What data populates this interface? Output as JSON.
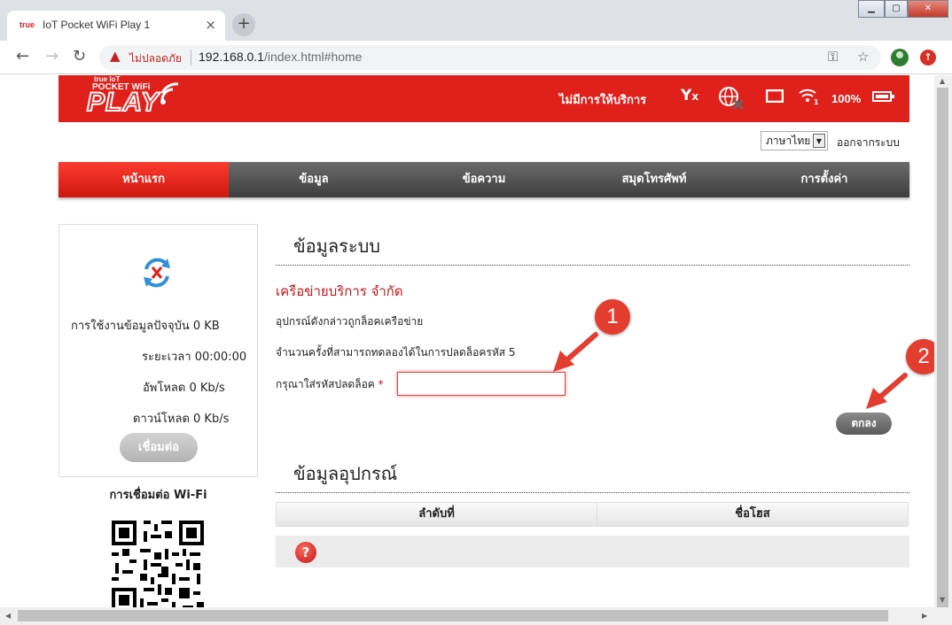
{
  "browser": {
    "tab_title": "IoT Pocket WiFi Play 1",
    "tab_favicon": "true",
    "url_security_label": "ไม่ปลอดภัย",
    "url_host": "192.168.0.1",
    "url_path": "/index.html#home",
    "window_controls": [
      "minimize",
      "maximize",
      "close"
    ]
  },
  "header": {
    "logo_small": "true IoT",
    "logo_pocket_wifi": "POCKET WiFi",
    "logo_play": "PLAY",
    "status_text": "ไม่มีการให้บริการ",
    "signal_icon_label": "Tx",
    "battery_percent": "100%",
    "accent_color": "#e0201b"
  },
  "top_links": {
    "language": "ภาษาไทย",
    "logout": "ออกจากระบบ"
  },
  "nav": {
    "items": [
      {
        "label": "หน้าแรก",
        "active": true
      },
      {
        "label": "ข้อมูล"
      },
      {
        "label": "ข้อความ"
      },
      {
        "label": "สมุดโทรศัพท์"
      },
      {
        "label": "การตั้งค่า"
      }
    ]
  },
  "left_panel": {
    "current_usage_label": "การใช้งานข้อมูลปัจจุบัน",
    "current_usage_value": "0 KB",
    "duration_label": "ระยะเวลา",
    "duration_value": "00:00:00",
    "upload_label": "อัพโหลด",
    "upload_value": "0 Kb/s",
    "download_label": "ดาวน์โหลด",
    "download_value": "0 Kb/s",
    "connect_button": "เชื่อมต่อ",
    "wifi_title": "การเชื่อมต่อ Wi-Fi"
  },
  "system_info": {
    "title": "ข้อมูลระบบ",
    "carrier": "เครือข่ายบริการ จำกัด",
    "locked_msg": "อุปกรณ์ดังกล่าวถูกล็อคเครือข่าย",
    "attempts_msg": "จำนวนครั้งที่สามารถทดลองได้ในการปลดล็อครหัส 5",
    "pin_label": "กรุณาใส่รหัสปลดล็อค",
    "pin_required": "*",
    "pin_value": "",
    "ok_button": "ตกลง"
  },
  "device_info": {
    "title": "ข้อมูลอุปกรณ์",
    "columns": [
      "ลำดับที่",
      "ชื่อโฮส"
    ]
  },
  "annotations": {
    "badge_1": "1",
    "badge_2": "2",
    "color": "#e33d2f"
  }
}
